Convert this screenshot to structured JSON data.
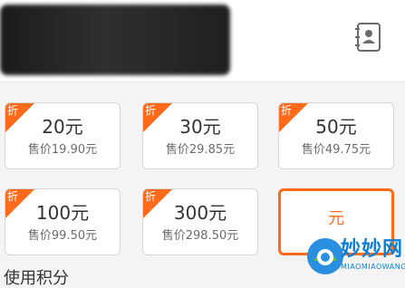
{
  "header": {
    "contact_icon": "contact-book-icon"
  },
  "options": [
    {
      "tag": "折",
      "denomination": "20元",
      "price": "售价19.90元",
      "selected": false
    },
    {
      "tag": "折",
      "denomination": "30元",
      "price": "售价29.85元",
      "selected": false
    },
    {
      "tag": "折",
      "denomination": "50元",
      "price": "售价49.75元",
      "selected": false
    },
    {
      "tag": "折",
      "denomination": "100元",
      "price": "售价99.50元",
      "selected": false
    },
    {
      "tag": "折",
      "denomination": "300元",
      "price": "售价298.50元",
      "selected": false
    }
  ],
  "custom_option": {
    "unit": "元",
    "selected": true
  },
  "footer": {
    "partial_label": "使用积分"
  },
  "watermark": {
    "brand": "妙妙网",
    "domain": "MIAOMIAOWANG"
  },
  "colors": {
    "accent": "#ff6a1b",
    "border": "#d7d7d7",
    "background": "#f4f4f4",
    "card_bg": "#ffffff"
  }
}
